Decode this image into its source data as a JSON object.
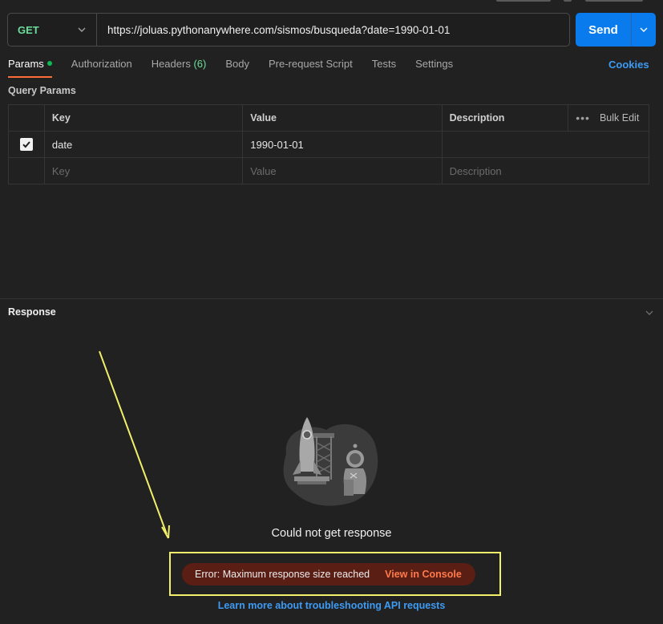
{
  "request": {
    "method": "GET",
    "url": "https://joluas.pythonanywhere.com/sismos/busqueda?date=1990-01-01",
    "send_label": "Send"
  },
  "tabs": [
    {
      "label": "Params",
      "active": true
    },
    {
      "label": "Authorization"
    },
    {
      "label": "Headers",
      "count": "(6)"
    },
    {
      "label": "Body"
    },
    {
      "label": "Pre-request Script"
    },
    {
      "label": "Tests"
    },
    {
      "label": "Settings"
    }
  ],
  "cookies_label": "Cookies",
  "query_params": {
    "title": "Query Params",
    "headers": {
      "key": "Key",
      "value": "Value",
      "description": "Description",
      "bulk_edit": "Bulk Edit",
      "more": "•••"
    },
    "rows": [
      {
        "checked": true,
        "key": "date",
        "value": "1990-01-01",
        "description": ""
      }
    ],
    "placeholders": {
      "key": "Key",
      "value": "Value",
      "description": "Description"
    }
  },
  "response": {
    "title": "Response",
    "empty_message": "Could not get response",
    "error_text": "Error: Maximum response size reached",
    "error_link": "View in Console",
    "learn_more": "Learn more about troubleshooting API requests"
  },
  "colors": {
    "accent_tab": "#ff6c37",
    "send": "#097bed",
    "method": "#6bdd9a",
    "link": "#3d9bf4",
    "error_bg": "#5a1e14",
    "error_link": "#ff7a4a",
    "highlight": "#f2ef6b"
  },
  "icons": {
    "method_dropdown": "chevron-down-icon",
    "send_dropdown": "chevron-down-icon",
    "response_collapse": "chevron-down-icon",
    "param_checkbox": "checkmark-icon",
    "illustration": "rocket-astronaut-illustration",
    "annotation": "arrow-annotation"
  }
}
